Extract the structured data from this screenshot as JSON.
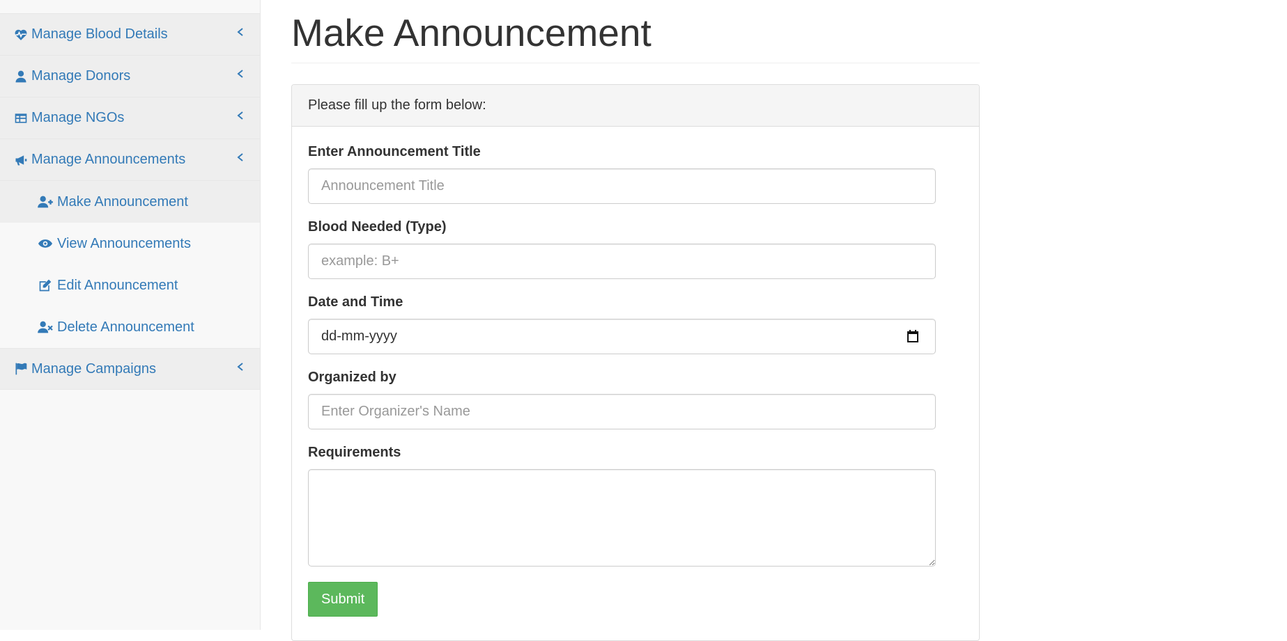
{
  "sidebar": {
    "items": [
      {
        "label": "Manage Blood Details",
        "icon": "heartbeat-icon"
      },
      {
        "label": "Manage Donors",
        "icon": "user-icon"
      },
      {
        "label": "Manage NGOs",
        "icon": "table-icon"
      },
      {
        "label": "Manage Announcements",
        "icon": "bullhorn-icon"
      },
      {
        "label": "Manage Campaigns",
        "icon": "flag-icon"
      }
    ],
    "sub_items": [
      {
        "label": "Make Announcement",
        "icon": "user-plus-icon"
      },
      {
        "label": "View Announcements",
        "icon": "eye-icon"
      },
      {
        "label": "Edit Announcement",
        "icon": "edit-icon"
      },
      {
        "label": "Delete Announcement",
        "icon": "user-times-icon"
      }
    ]
  },
  "page": {
    "title": "Make Announcement"
  },
  "form": {
    "heading": "Please fill up the form below:",
    "title_label": "Enter Announcement Title",
    "title_placeholder": "Announcement Title",
    "blood_label": "Blood Needed (Type)",
    "blood_placeholder": "example: B+",
    "date_label": "Date and Time",
    "date_value": "dd-mm-yyyy",
    "organizer_label": "Organized by",
    "organizer_placeholder": "Enter Organizer's Name",
    "requirements_label": "Requirements",
    "requirements_value": "",
    "submit_label": "Submit"
  },
  "colors": {
    "link": "#337ab7",
    "submit": "#5cb85c",
    "sidebar_bg": "#f8f8f8",
    "active_bg": "#eeeeee"
  }
}
